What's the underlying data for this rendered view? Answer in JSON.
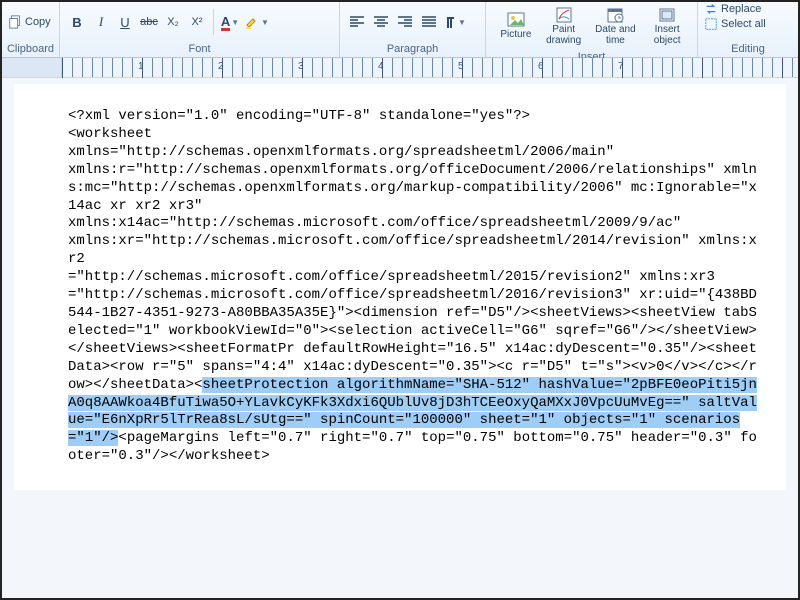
{
  "ribbon": {
    "clipboard": {
      "label": "Clipboard",
      "copy": "Copy"
    },
    "font": {
      "label": "Font",
      "bold": "B",
      "italic": "I",
      "underline": "U",
      "strike": "abc",
      "sub": "X₂",
      "sup": "X²",
      "font_color": "A",
      "highlight": "A"
    },
    "paragraph": {
      "label": "Paragraph"
    },
    "insert": {
      "label": "Insert",
      "picture": "Picture",
      "paint": "Paint drawing",
      "datetime": "Date and time",
      "object": "Insert object"
    },
    "editing": {
      "label": "Editing",
      "replace": "Replace",
      "select_all": "Select all"
    }
  },
  "ruler_numbers": [
    "1",
    "2",
    "3",
    "4",
    "5",
    "6",
    "7"
  ],
  "document": {
    "pre_highlight": "<?xml version=\"1.0\" encoding=\"UTF-8\" standalone=\"yes\"?>\n<worksheet\nxmlns=\"http://schemas.openxmlformats.org/spreadsheetml/2006/main\"\nxmlns:r=\"http://schemas.openxmlformats.org/officeDocument/2006/relationships\" xmlns:mc=\"http://schemas.openxmlformats.org/markup-compatibility/2006\" mc:Ignorable=\"x14ac xr xr2 xr3\"\nxmlns:x14ac=\"http://schemas.microsoft.com/office/spreadsheetml/2009/9/ac\"\nxmlns:xr=\"http://schemas.microsoft.com/office/spreadsheetml/2014/revision\" xmlns:xr2\n=\"http://schemas.microsoft.com/office/spreadsheetml/2015/revision2\" xmlns:xr3\n=\"http://schemas.microsoft.com/office/spreadsheetml/2016/revision3\" xr:uid=\"{438BD544-1B27-4351-9273-A80BBA35A35E}\"><dimension ref=\"D5\"/><sheetViews><sheetView tabSelected=\"1\" workbookViewId=\"0\"><selection activeCell=\"G6\" sqref=\"G6\"/></sheetView></sheetViews><sheetFormatPr defaultRowHeight=\"16.5\" x14ac:dyDescent=\"0.35\"/><sheetData><row r=\"5\" spans=\"4:4\" x14ac:dyDescent=\"0.35\"><c r=\"D5\" t=\"s\"><v>0</v></c></row></sheetData><",
    "highlight": "sheetProtection algorithmName=\"SHA-512\" hashValue=\"2pBFE0eoPiti5jnA0q8AAWkoa4BfuTiwa5O+YLavkCyKFk3Xdxi6QUblUv8jD3hTCEeOxyQaMXxJ0VpcUuMvEg==\" saltValue=\"E6nXpRr5lTrRea8sL/sUtg==\" spinCount=\"100000\" sheet=\"1\" objects=\"1\" scenarios=\"1\"/>",
    "post_highlight": "<pageMargins left=\"0.7\" right=\"0.7\" top=\"0.75\" bottom=\"0.75\" header=\"0.3\" footer=\"0.3\"/></worksheet>"
  }
}
